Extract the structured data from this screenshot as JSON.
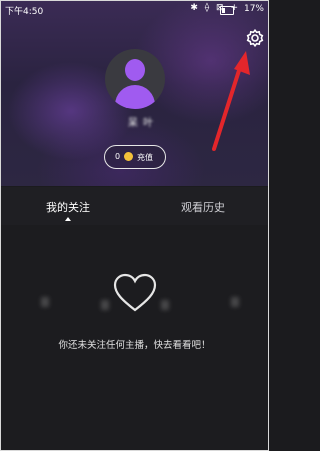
{
  "status_bar": {
    "time": "下午4:50",
    "icons": "✱ ⟠ ⊠ +",
    "battery": "17%"
  },
  "profile": {
    "username": "呆 叶",
    "coin_count": "0",
    "recharge_label": "充值"
  },
  "tabs": [
    {
      "label": "我的关注",
      "active": true
    },
    {
      "label": "观看历史",
      "active": false
    }
  ],
  "empty_state": {
    "message": "你还未关注任何主播，快去看看吧！"
  },
  "colors": {
    "accent_purple": "#a05bf0",
    "annotation_red": "#e3262b",
    "coin_gold": "#f3c13a"
  }
}
